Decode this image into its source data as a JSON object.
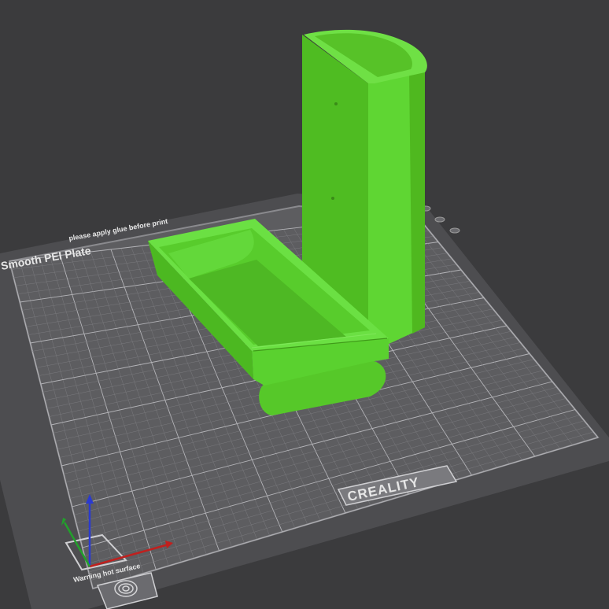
{
  "viewport": {
    "background_color": "#3b3b3d"
  },
  "build_plate": {
    "surface_color": "#5d5d60",
    "grid_line_color": "#7a7a7e",
    "grid_major_color": "#b4b4b8",
    "frame_color": "#4a4a4d",
    "top_label": "please apply glue before print",
    "plate_name": "Smooth PEI Plate",
    "brand_logo": "CREALITY",
    "warning_label": "Warning hot surface",
    "warning_icon": "hot-surface-warning-icon",
    "fingerprint_icon": "fingerprint-icon"
  },
  "models": [
    {
      "name": "vertical-holder",
      "color": "#5ccd2e"
    },
    {
      "name": "tray",
      "color": "#5ccd2e"
    }
  ],
  "axes": {
    "x_color": "#c0201e",
    "y_color": "#22a02b",
    "z_color": "#2a3ad0"
  }
}
